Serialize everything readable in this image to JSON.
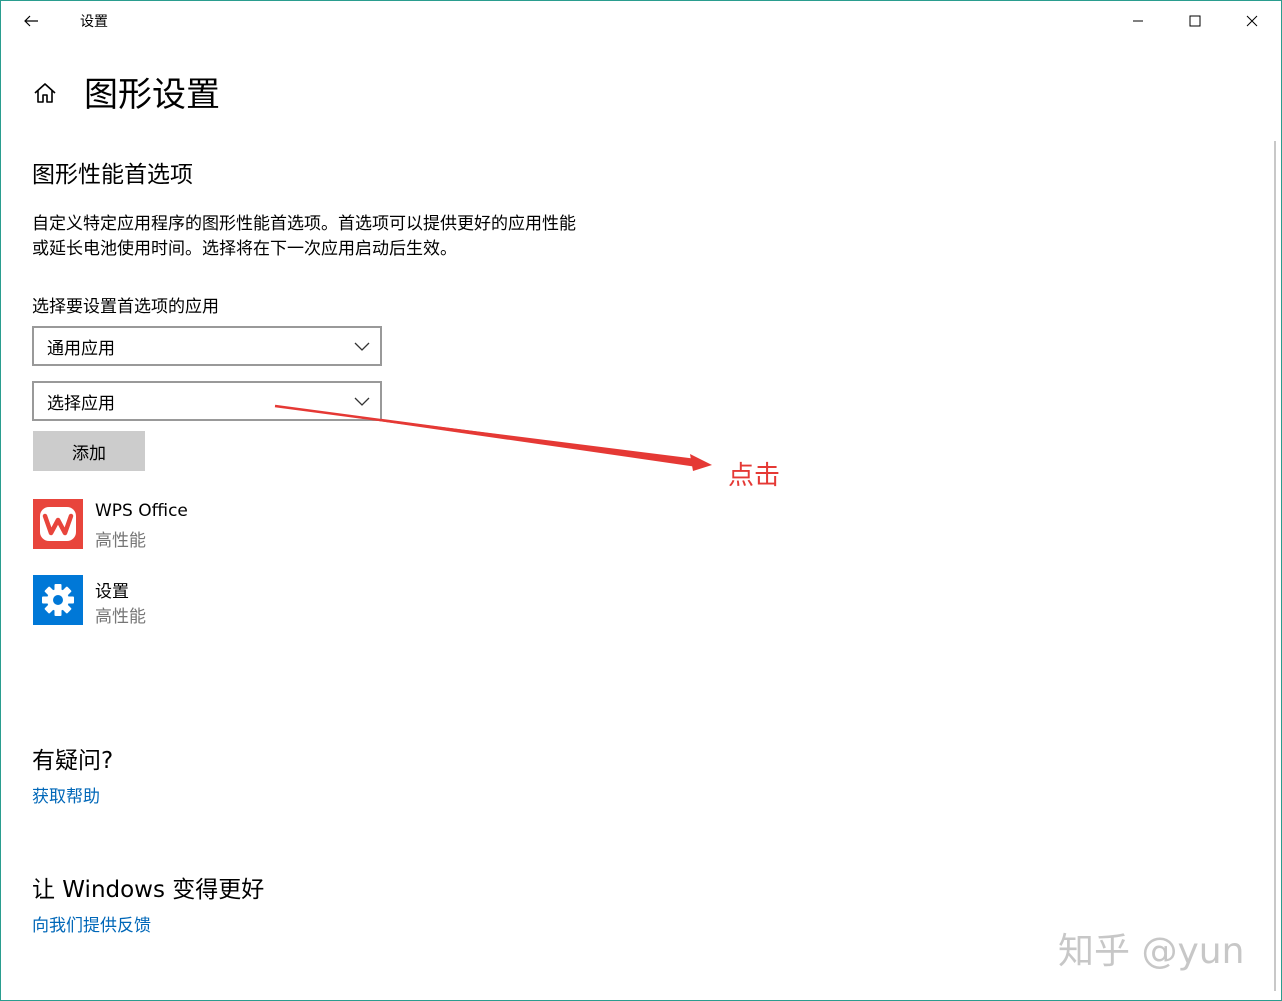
{
  "window": {
    "title": "设置",
    "border_color": "#2a9d8f"
  },
  "titlebar": {
    "back_icon": "back-arrow-icon",
    "min_icon": "minimize-icon",
    "max_icon": "maximize-icon",
    "close_icon": "close-icon"
  },
  "header": {
    "home_icon": "home-icon",
    "page_title": "图形设置"
  },
  "section": {
    "title": "图形性能首选项",
    "description": "自定义特定应用程序的图形性能首选项。首选项可以提供更好的应用性能或延长电池使用时间。选择将在下一次应用启动后生效。",
    "select_label": "选择要设置首选项的应用",
    "dropdown_type": {
      "value": "通用应用"
    },
    "dropdown_app": {
      "value": "选择应用"
    },
    "add_button": "添加"
  },
  "apps": [
    {
      "name": "WPS Office",
      "perf": "高性能",
      "icon": "wps-office-icon",
      "icon_color": "#e8453c"
    },
    {
      "name": "设置",
      "perf": "高性能",
      "icon": "settings-gear-icon",
      "icon_color": "#0078d7"
    }
  ],
  "questions": {
    "title": "有疑问?",
    "help_link": "获取帮助"
  },
  "feedback": {
    "title": "让 Windows 变得更好",
    "link": "向我们提供反馈"
  },
  "annotation": {
    "text": "点击",
    "color": "#e53935"
  },
  "watermark": "知乎 @yun",
  "colors": {
    "link": "#0067b8",
    "button_bg": "#cccccc",
    "secondary_text": "#767676"
  }
}
